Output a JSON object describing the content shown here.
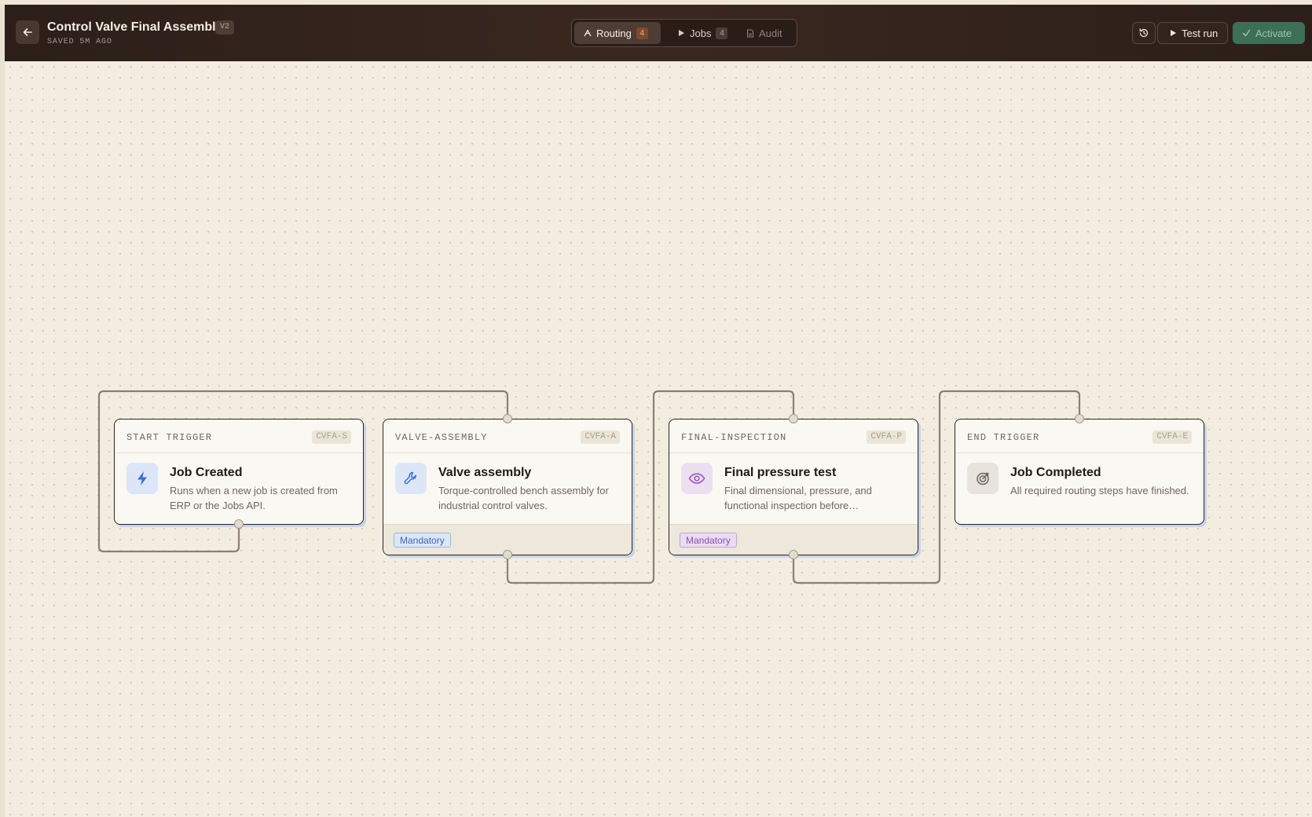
{
  "header": {
    "title": "Control Valve Final Assembly",
    "version": "V2",
    "saved_status": "SAVED 5M AGO"
  },
  "tabs": [
    {
      "label": "Routing",
      "count": "4",
      "active": true
    },
    {
      "label": "Jobs",
      "count": "4"
    },
    {
      "label": "Audit"
    }
  ],
  "actions": {
    "test_run": "Test run",
    "activate": "Activate"
  },
  "nodes": [
    {
      "type": "START TRIGGER",
      "code": "CVFA-S",
      "title": "Job Created",
      "description": "Runs when a new job is created from ERP or the Jobs API.",
      "icon": "lightning-icon"
    },
    {
      "type": "VALVE-ASSEMBLY",
      "code": "CVFA-A",
      "title": "Valve assembly",
      "description": "Torque-controlled bench assembly for industrial control valves.",
      "badge": "Mandatory",
      "icon": "wrench-icon"
    },
    {
      "type": "FINAL-INSPECTION",
      "code": "CVFA-P",
      "title": "Final pressure test",
      "description": "Final dimensional, pressure, and functional inspection before…",
      "badge": "Mandatory",
      "icon": "eye-icon"
    },
    {
      "type": "END TRIGGER",
      "code": "CVFA-E",
      "title": "Job Completed",
      "description": "All required routing steps have finished.",
      "icon": "target-icon"
    }
  ],
  "colors": {
    "header_bg": "#2c1e19",
    "canvas_bg": "#f3ede0",
    "edge": "#8a7f73",
    "accent_routing": "#f0b07a",
    "activate_bg": "#3f6e57",
    "badge_blue": "#3e67b0",
    "badge_purple": "#8a4fb0"
  }
}
